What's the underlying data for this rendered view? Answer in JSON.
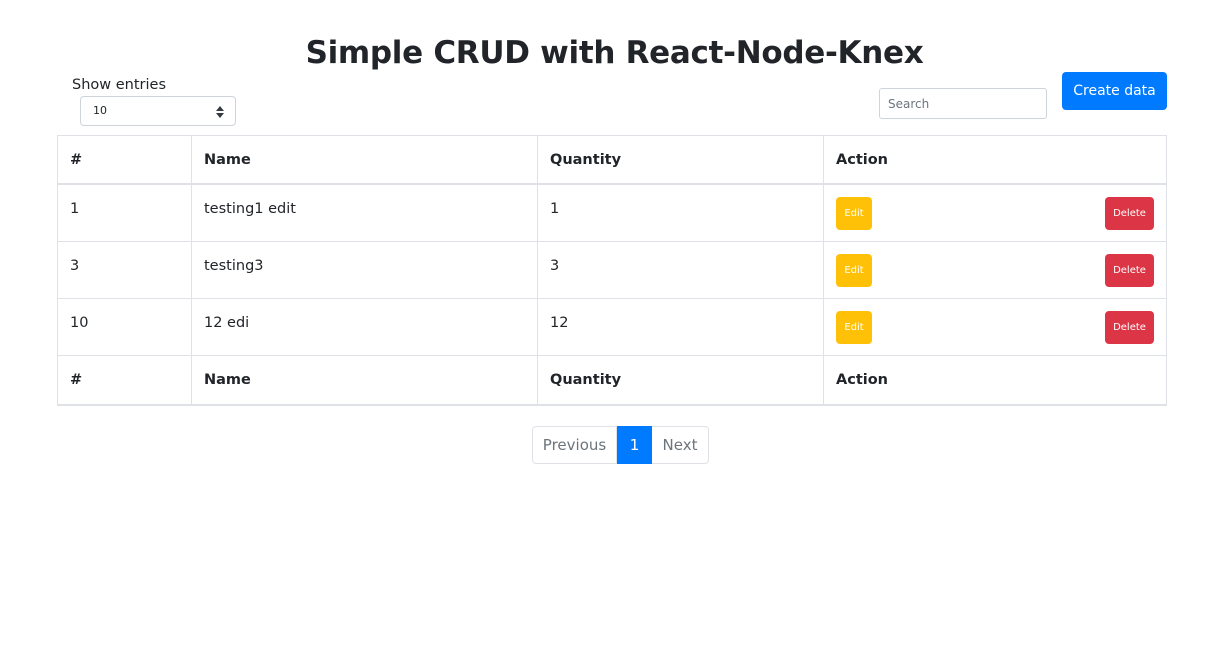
{
  "title": "Simple CRUD with React-Node-Knex",
  "entries": {
    "label": "Show entries",
    "selected": "10"
  },
  "search": {
    "placeholder": "Search",
    "value": ""
  },
  "create_button": "Create data",
  "table": {
    "headers": [
      "#",
      "Name",
      "Quantity",
      "Action"
    ],
    "footers": [
      "#",
      "Name",
      "Quantity",
      "Action"
    ],
    "rows": [
      {
        "id": "1",
        "name": "testing1 edit",
        "quantity": "1",
        "edit": "Edit",
        "delete": "Delete"
      },
      {
        "id": "3",
        "name": "testing3",
        "quantity": "3",
        "edit": "Edit",
        "delete": "Delete"
      },
      {
        "id": "10",
        "name": "12 edi",
        "quantity": "12",
        "edit": "Edit",
        "delete": "Delete"
      }
    ]
  },
  "pagination": {
    "previous": "Previous",
    "current": "1",
    "next": "Next"
  },
  "colors": {
    "primary": "#007bff",
    "warning": "#ffc107",
    "danger": "#dc3545"
  }
}
